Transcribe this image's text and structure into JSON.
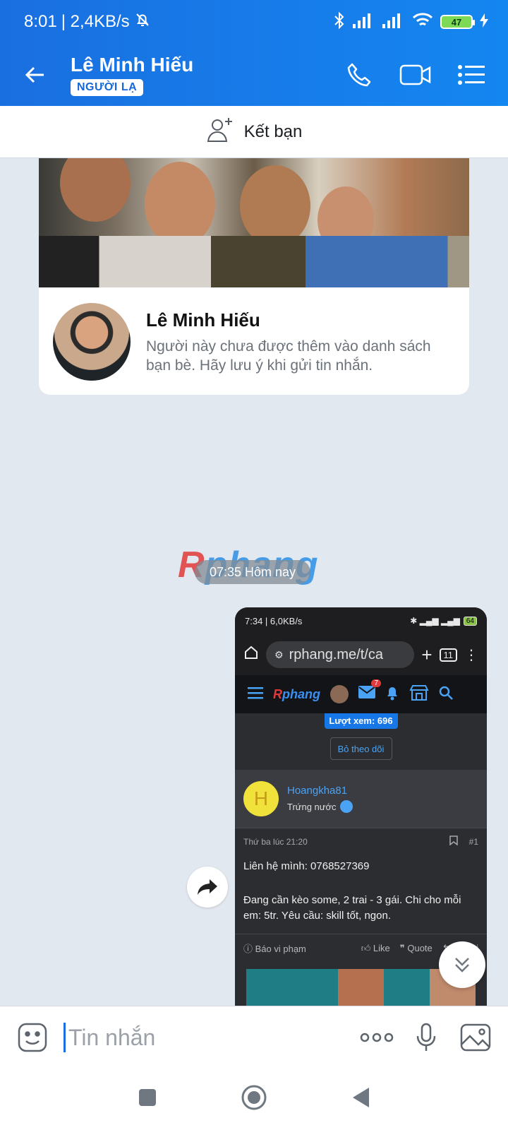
{
  "status_bar": {
    "time": "8:01",
    "network_speed": "| 2,4KB/s",
    "battery": "47"
  },
  "header": {
    "contact_name": "Lê Minh Hiếu",
    "badge": "NGƯỜI LẠ"
  },
  "add_friend": {
    "label": "Kết bạn"
  },
  "profile_card": {
    "name": "Lê Minh Hiếu",
    "note": "Người này chưa được thêm vào danh sách bạn bè. Hãy lưu ý khi gửi tin nhắn."
  },
  "watermark": {
    "r": "R",
    "rest": "phang"
  },
  "time_divider": "07:35 Hôm nay",
  "screenshot": {
    "status_time": "7:34 | 6,0KB/s",
    "battery": "64",
    "url": "rphang.me/t/ca",
    "tab_count": "11",
    "brand_r": "R",
    "brand_rest": "phang",
    "mail_count": "7",
    "views": "Lượt xem: 696",
    "unfollow": "Bỏ theo dõi",
    "user_initial": "H",
    "username": "Hoangkha81",
    "rank": "Trứng nước",
    "post_date": "Thứ ba lúc 21:20",
    "post_number": "#1",
    "post_line1": "Liên hệ mình: 0768527369",
    "post_line2": "Đang cần kèo some, 2 trai - 3 gái. Chi cho mỗi em: 5tr. Yêu cầu: skill tốt, ngon.",
    "report": "Báo vi phạm",
    "like": "Like",
    "quote": "Quote",
    "reply": "Trả lời"
  },
  "composer": {
    "placeholder": "Tin nhắn"
  }
}
